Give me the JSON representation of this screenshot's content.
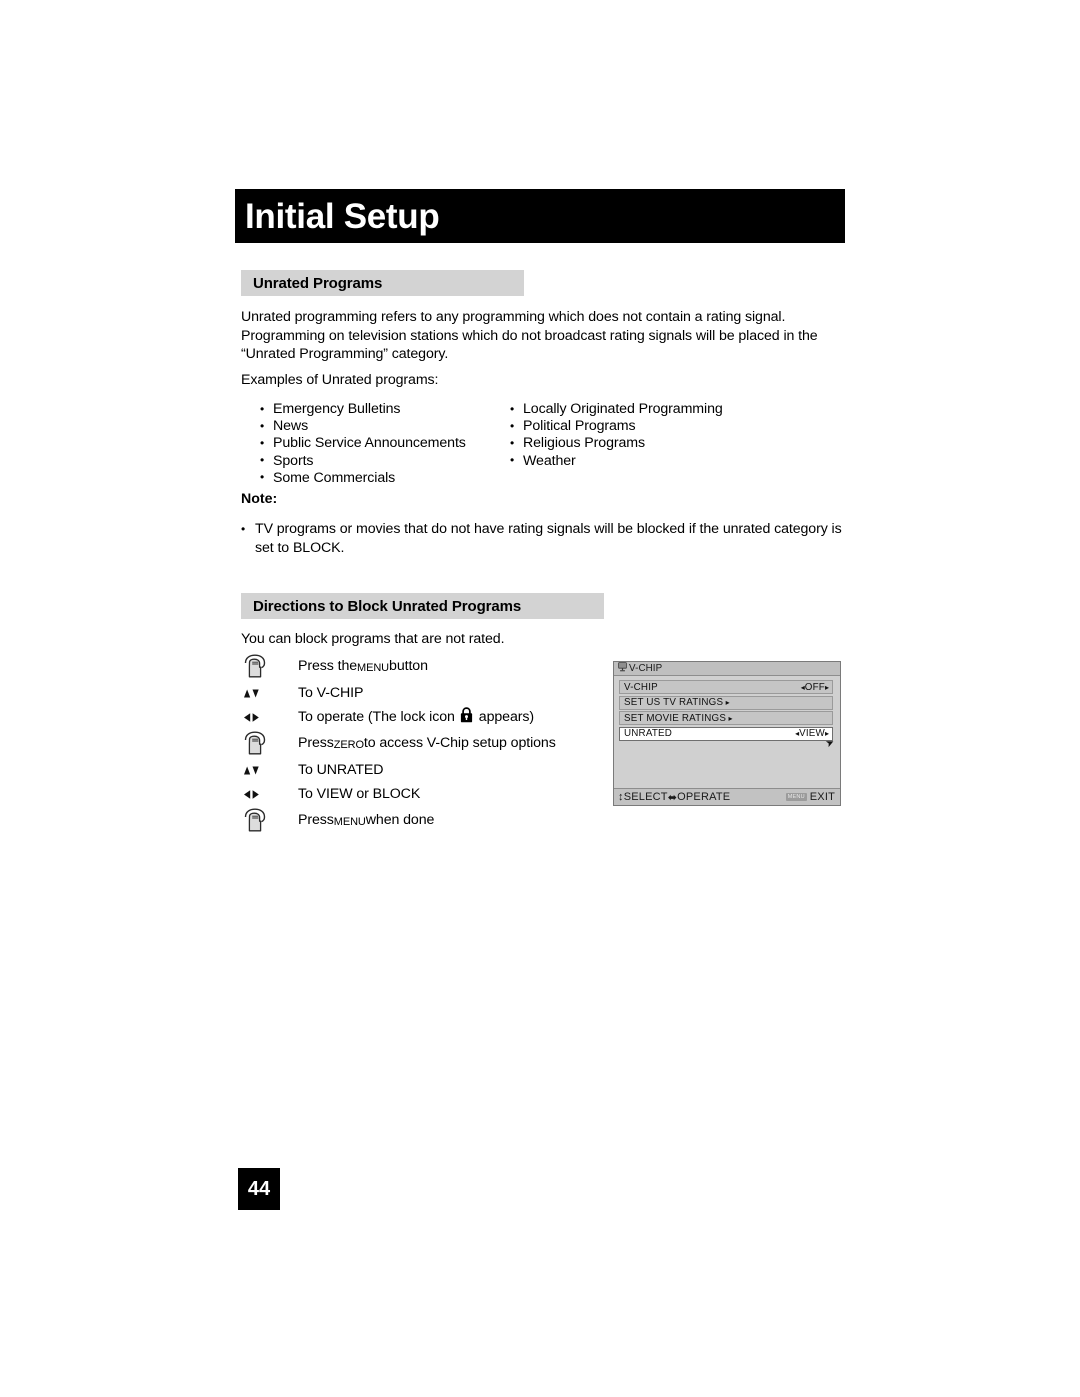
{
  "document": {
    "chapter_title": "Initial Setup",
    "page_number": "44"
  },
  "sections": {
    "unrated": {
      "heading": "Unrated Programs",
      "intro": "Unrated programming refers to any programming which does not contain a rating signal. Programming on television stations which do not broadcast rating signals will be placed in the “Unrated Programming” category.",
      "examples_label": "Examples of Unrated programs:",
      "examples_left": [
        "Emergency Bulletins",
        "News",
        "Public Service Announcements",
        "Sports",
        "Some Commercials"
      ],
      "examples_right": [
        "Locally Originated Programming",
        "Political Programs",
        "Religious Programs",
        "Weather"
      ],
      "note_label": "Note:",
      "note_text": "TV programs or movies that do not have rating signals will be blocked if the unrated category is set to BLOCK."
    },
    "directions": {
      "heading": "Directions to Block Unrated Programs",
      "intro": "You can block programs that are not rated.",
      "steps": [
        {
          "icon": "hand-press-button-icon",
          "text_before": "Press the ",
          "key": "MENU",
          "text_after": " button"
        },
        {
          "icon": "up-down-arrows-icon",
          "text_before": "To V-CHIP",
          "key": "",
          "text_after": ""
        },
        {
          "icon": "left-right-arrows-icon",
          "text_before": "To operate (The lock icon",
          "key": "",
          "text_after": "appears)"
        },
        {
          "icon": "hand-press-button-icon",
          "text_before": "Press ",
          "key": "ZERO",
          "text_after": " to access V-Chip setup options"
        },
        {
          "icon": "up-down-arrows-icon",
          "text_before": "To UNRATED",
          "key": "",
          "text_after": ""
        },
        {
          "icon": "left-right-arrows-icon",
          "text_before": "To VIEW or BLOCK",
          "key": "",
          "text_after": ""
        },
        {
          "icon": "hand-press-button-icon",
          "text_before": "Press ",
          "key": "MENU",
          "text_after": " when done"
        }
      ]
    }
  },
  "osd_menu": {
    "title": "V-CHIP",
    "rows": [
      {
        "label": "V-CHIP",
        "value": "OFF",
        "arrows": "both",
        "selected": false
      },
      {
        "label": "SET US TV RATINGS",
        "value": "",
        "arrows": "right",
        "selected": false
      },
      {
        "label": "SET MOVIE RATINGS",
        "value": "",
        "arrows": "right",
        "selected": false
      },
      {
        "label": "UNRATED",
        "value": "VIEW",
        "arrows": "both",
        "selected": true
      }
    ],
    "footer": {
      "select_label": "SELECT",
      "operate_label": "OPERATE",
      "menu_badge": "MENU",
      "exit_label": "EXIT"
    }
  },
  "colors": {
    "title_bar_bg": "#000000",
    "section_head_bg": "#d3d3d3",
    "osd_panel_bg": "#d0d0d0",
    "osd_row_bg": "#c5c5c5",
    "osd_selected_bg": "#ffffff",
    "page_num_bg": "#000000"
  }
}
